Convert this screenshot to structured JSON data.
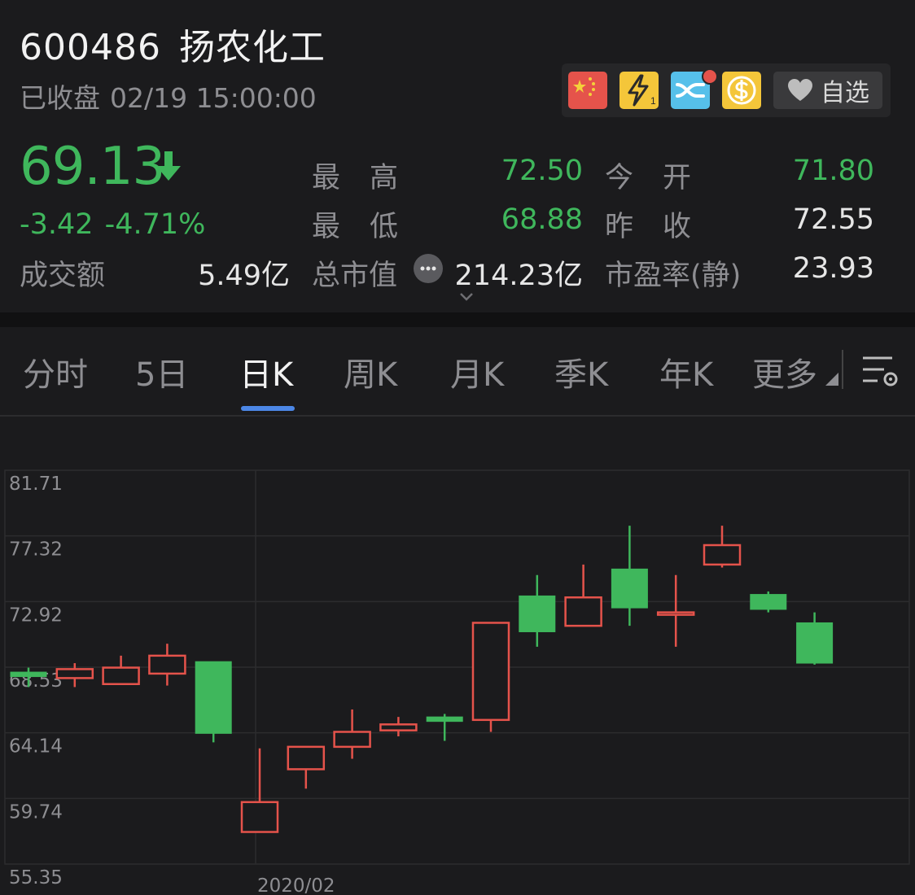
{
  "stock": {
    "code": "600486",
    "name": "扬农化工",
    "status": "已收盘",
    "datetime": "02/19 15:00:00",
    "price": "69.13",
    "change": "-3.42",
    "change_pct": "-4.71%"
  },
  "tags": {
    "icons": [
      "china-flag-icon",
      "lightning-icon",
      "connect-icon",
      "dollar-icon"
    ],
    "watch_label": "自选"
  },
  "stats": {
    "high_label": "最高",
    "high_value": "72.50",
    "open_label": "今开",
    "open_value": "71.80",
    "low_label": "最低",
    "low_value": "68.88",
    "prev_close_label": "昨收",
    "prev_close_value": "72.55",
    "turnover_label": "成交额",
    "turnover_value": "5.49亿",
    "market_cap_label": "总市值",
    "market_cap_value": "214.23亿",
    "pe_label": "市盈率(静)",
    "pe_value": "23.93"
  },
  "tabs": [
    {
      "label": "分时"
    },
    {
      "label": "5日"
    },
    {
      "label": "日K"
    },
    {
      "label": "周K"
    },
    {
      "label": "月K"
    },
    {
      "label": "季K"
    },
    {
      "label": "年K"
    },
    {
      "label": "更多"
    }
  ],
  "active_tab": "日K",
  "colors": {
    "up": "#e5534b",
    "down": "#3fb75c",
    "accent": "#4c87e6"
  },
  "chart_data": {
    "type": "candlestick",
    "y_ticks": [
      "81.71",
      "77.32",
      "72.92",
      "68.53",
      "64.14",
      "59.74",
      "55.35"
    ],
    "ylim": [
      55.35,
      81.71
    ],
    "x_label": "2020/02",
    "x_label_index": 5,
    "grid": true,
    "candles": [
      {
        "open": 68.2,
        "close": 67.9,
        "high": 68.5,
        "low": 67.2,
        "dir": "down"
      },
      {
        "open": 67.8,
        "close": 68.4,
        "high": 68.8,
        "low": 67.2,
        "dir": "up"
      },
      {
        "open": 67.4,
        "close": 68.5,
        "high": 69.3,
        "low": 67.4,
        "dir": "up"
      },
      {
        "open": 68.1,
        "close": 69.3,
        "high": 70.1,
        "low": 67.3,
        "dir": "up"
      },
      {
        "open": 68.9,
        "close": 64.1,
        "high": 68.9,
        "low": 63.5,
        "dir": "down"
      },
      {
        "open": 57.5,
        "close": 59.5,
        "high": 63.1,
        "low": 57.5,
        "dir": "up"
      },
      {
        "open": 61.7,
        "close": 63.2,
        "high": 63.2,
        "low": 60.4,
        "dir": "up"
      },
      {
        "open": 63.2,
        "close": 64.2,
        "high": 65.7,
        "low": 62.4,
        "dir": "up"
      },
      {
        "open": 64.3,
        "close": 64.7,
        "high": 65.2,
        "low": 63.9,
        "dir": "up"
      },
      {
        "open": 65.2,
        "close": 64.9,
        "high": 65.4,
        "low": 63.6,
        "dir": "down"
      },
      {
        "open": 65.0,
        "close": 71.5,
        "high": 71.5,
        "low": 64.2,
        "dir": "up"
      },
      {
        "open": 73.3,
        "close": 70.9,
        "high": 74.7,
        "low": 69.9,
        "dir": "down"
      },
      {
        "open": 71.3,
        "close": 73.2,
        "high": 75.4,
        "low": 71.3,
        "dir": "up"
      },
      {
        "open": 75.1,
        "close": 72.5,
        "high": 78.0,
        "low": 71.3,
        "dir": "down"
      },
      {
        "open": 72.2,
        "close": 72.1,
        "high": 74.7,
        "low": 69.9,
        "dir": "up"
      },
      {
        "open": 75.4,
        "close": 76.7,
        "high": 78.0,
        "low": 75.2,
        "dir": "up"
      },
      {
        "open": 73.4,
        "close": 72.4,
        "high": 73.6,
        "low": 72.2,
        "dir": "down"
      },
      {
        "open": 71.5,
        "close": 68.8,
        "high": 72.2,
        "low": 68.7,
        "dir": "down"
      }
    ]
  }
}
